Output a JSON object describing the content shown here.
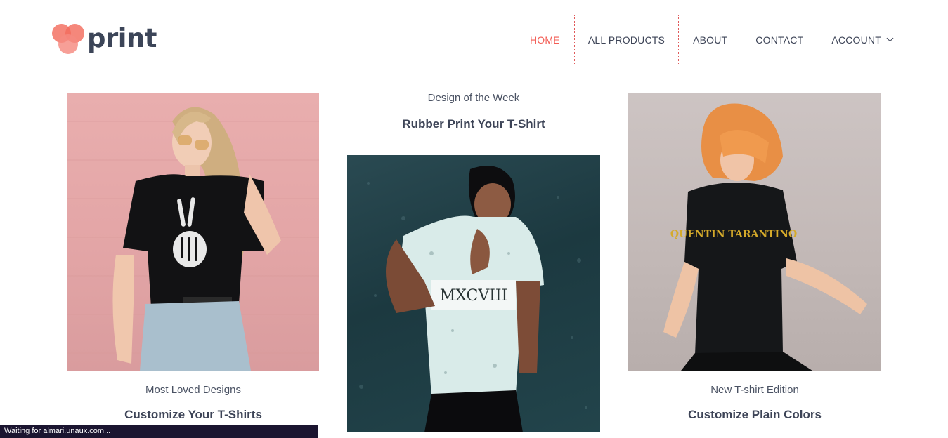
{
  "logo": {
    "text": "print",
    "brand_color": "#f36c5e"
  },
  "nav": {
    "items": [
      {
        "label": "HOME",
        "active": true
      },
      {
        "label": "ALL PRODUCTS",
        "focused": true
      },
      {
        "label": "ABOUT"
      },
      {
        "label": "CONTACT"
      },
      {
        "label": "ACCOUNT",
        "has_dropdown": true
      }
    ],
    "active_color": "#f35d55"
  },
  "cards": [
    {
      "subtitle": "Most Loved Designs",
      "title": "Customize Your T-Shirts"
    },
    {
      "subtitle": "Design of the Week",
      "title": "Rubber Print Your T-Shirt"
    },
    {
      "subtitle": "New T-shirt Edition",
      "title": "Customize Plain Colors"
    }
  ],
  "images": [
    {
      "print_text": ""
    },
    {
      "print_text": "MXCVIII"
    },
    {
      "print_text": "QUENTIN TARANTINO"
    }
  ],
  "status": {
    "text": "Waiting for almari.unaux.com..."
  }
}
